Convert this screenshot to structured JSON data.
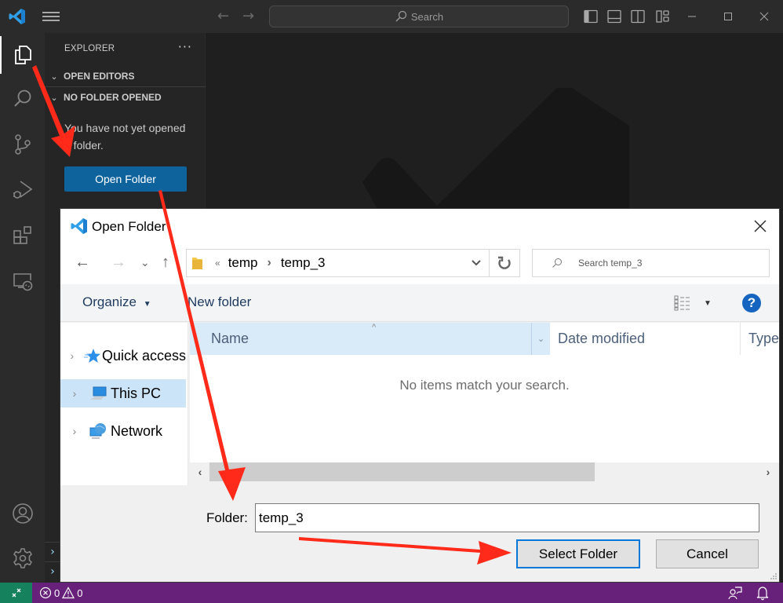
{
  "titlebar": {
    "search_label": "Search",
    "icons": [
      "vscode-logo",
      "hamburger-menu",
      "back-arrow",
      "forward-arrow",
      "toggle-primary-sidebar",
      "toggle-panel",
      "toggle-secondary-sidebar",
      "customize-layout",
      "minimize",
      "maximize",
      "close"
    ]
  },
  "activitybar": {
    "items": [
      {
        "name": "explorer",
        "active": true
      },
      {
        "name": "search"
      },
      {
        "name": "source-control"
      },
      {
        "name": "run-and-debug"
      },
      {
        "name": "extensions"
      },
      {
        "name": "remote-explorer"
      }
    ],
    "bottom": [
      {
        "name": "accounts"
      },
      {
        "name": "manage"
      }
    ]
  },
  "sidebar": {
    "title": "EXPLORER",
    "more_label": "···",
    "sections": [
      {
        "label": "OPEN EDITORS",
        "chevron": "⌄"
      },
      {
        "label": "NO FOLDER OPENED",
        "chevron": "⌄"
      }
    ],
    "message": "You have not yet opened a folder.",
    "open_folder_label": "Open Folder",
    "collapsed_chevron": "›"
  },
  "dialog": {
    "title": "Open Folder",
    "nav": {
      "back": "←",
      "forward": "→",
      "recent": "⌄",
      "up": "↑"
    },
    "breadcrumb": {
      "overflow": "«",
      "items": [
        "temp",
        "temp_3"
      ],
      "separator": "›"
    },
    "search_placeholder": "Search temp_3",
    "toolbar": {
      "organize_label": "Organize",
      "new_folder_label": "New folder",
      "help_label": "?"
    },
    "tree": [
      {
        "label": "Quick access",
        "icon": "star-icon",
        "selected": false
      },
      {
        "label": "This PC",
        "icon": "computer-icon",
        "selected": true
      },
      {
        "label": "Network",
        "icon": "network-icon",
        "selected": false
      }
    ],
    "columns": [
      "Name",
      "Date modified",
      "Type"
    ],
    "empty_message": "No items match your search.",
    "scroll": {
      "thumb_fraction": 0.7
    },
    "folder_label": "Folder:",
    "folder_value": "temp_3",
    "select_label": "Select Folder",
    "cancel_label": "Cancel"
  },
  "statusbar": {
    "errors": "0",
    "warnings": "0"
  },
  "colors": {
    "accent": "#0e639c",
    "statusbar": "#68217a",
    "remote": "#16825d",
    "annotation": "#ff2a1a"
  }
}
